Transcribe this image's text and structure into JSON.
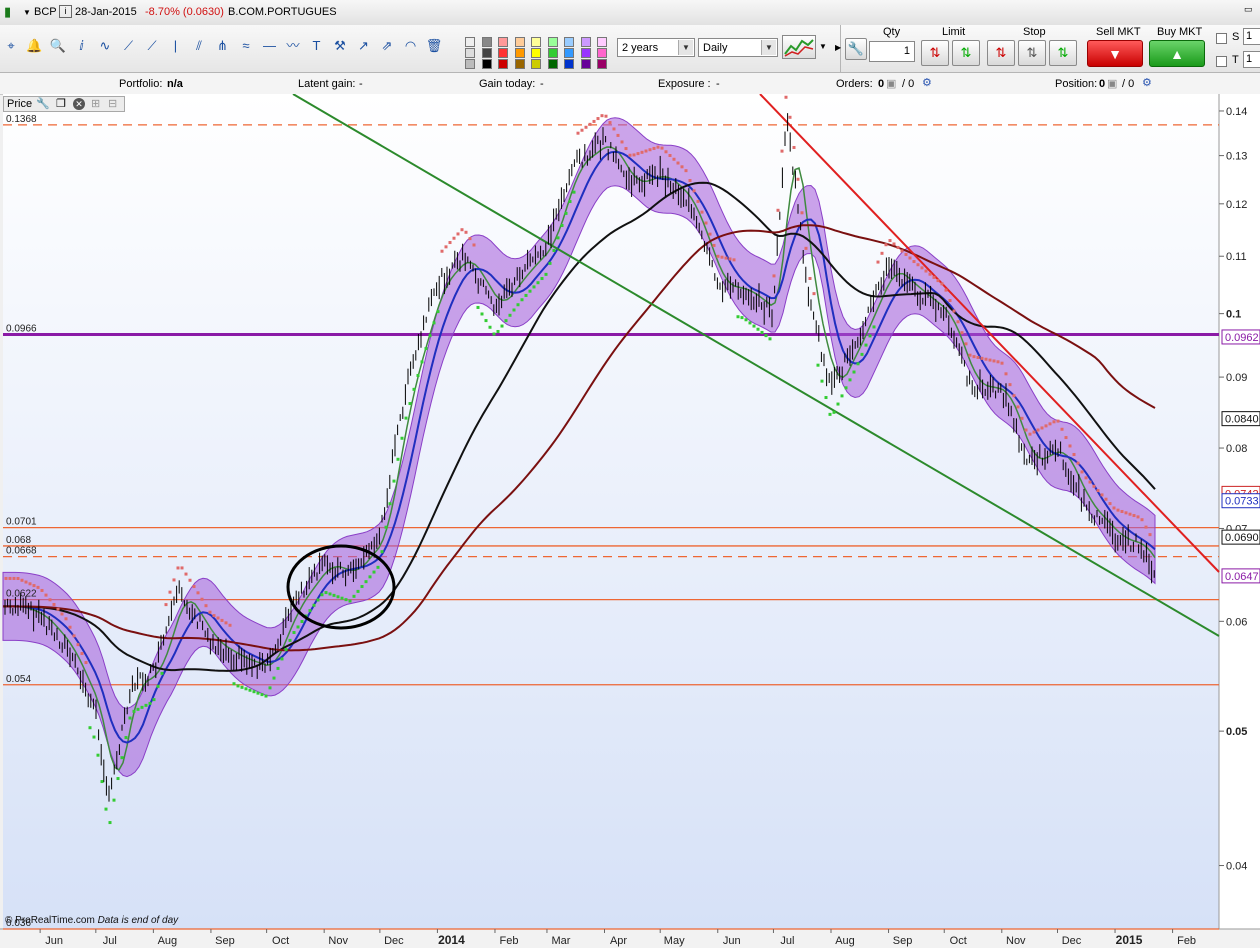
{
  "header": {
    "symbol": "BCP",
    "date": "28-Jan-2015",
    "change": "-8.70% (0.0630)",
    "name": "B.COM.PORTUGUES",
    "info_icon": "info-icon"
  },
  "toolbar": {
    "period": "2 years",
    "interval": "Daily",
    "icons": [
      "crosshair-icon",
      "alert-bell-icon",
      "zoom-icon",
      "fibonacci-icon",
      "indicator-icon",
      "line-tool-icon",
      "ray-tool-icon",
      "vertical-line-icon",
      "parallel-channel-icon",
      "pitchfork-icon",
      "regression-icon",
      "horizontal-line-icon",
      "trend-icon",
      "text-icon",
      "tools-icon",
      "arrow-icon",
      "arrow-pair-icon",
      "arc-icon",
      "trash-icon"
    ],
    "swatches": [
      "#eeeeee",
      "#dddddd",
      "#bbbbbb",
      "#888888",
      "#444444",
      "#000000",
      "#ff9999",
      "#ff3333",
      "#cc0000",
      "#ffcc99",
      "#ff9900",
      "#996600",
      "#ffff99",
      "#ffff00",
      "#cccc00",
      "#99ff99",
      "#33cc33",
      "#006600",
      "#99ccff",
      "#3399ff",
      "#0033cc",
      "#cc99ff",
      "#9933ff",
      "#660099",
      "#ffccff",
      "#ff66cc",
      "#990066"
    ]
  },
  "order": {
    "qty_label": "Qty",
    "qty_value": "1",
    "limit_label": "Limit",
    "stop_label": "Stop",
    "sell_label": "Sell MKT",
    "buy_label": "Buy MKT",
    "s_label": "S",
    "t_label": "T",
    "s_value": "1",
    "t_value": "1"
  },
  "info": {
    "portfolio_label": "Portfolio:",
    "portfolio_value": "n/a",
    "latent_label": "Latent gain:",
    "latent_value": "-",
    "gain_today_label": "Gain today:",
    "gain_today_value": "-",
    "exposure_label": "Exposure :",
    "exposure_value": "-",
    "orders_label": "Orders:",
    "orders_value": "0",
    "orders_value2": "/ 0",
    "position_label": "Position:",
    "position_value": "0",
    "position_value2": "/ 0"
  },
  "price_panel": {
    "label": "Price"
  },
  "footer": {
    "copyright": "© ProRealTime.com",
    "note": "Data is end of day"
  },
  "colors": {
    "band_fill": "#a259d9",
    "ma_blue": "#1f2fbf",
    "ma_black": "#111111",
    "ma_maroon": "#7a1010",
    "ma_green": "#3f8a3f",
    "trend_green": "#2c8a2c",
    "trend_red": "#e02020",
    "support_orange": "#ee6633",
    "resistance_purple": "#8a1aa6",
    "sar_green": "#33cc33",
    "sar_red": "#e06a6a"
  },
  "chart_data": {
    "type": "candlestick",
    "scale": "log",
    "ylim": [
      0.036,
      0.144
    ],
    "y_ticks": [
      0.04,
      0.05,
      0.06,
      0.07,
      0.08,
      0.09,
      0.1,
      0.11,
      0.12,
      0.13,
      0.14
    ],
    "y_tick_labels": [
      "0.04",
      "0.05",
      "0.06",
      "0.07",
      "0.08",
      "0.09",
      "0.1",
      "0.11",
      "0.12",
      "0.13",
      "0.14"
    ],
    "y_major_ticks": [
      "0.05",
      "0.1"
    ],
    "x_labels": [
      "Jun",
      "Jul",
      "Aug",
      "Sep",
      "Oct",
      "Nov",
      "Dec",
      "2014",
      "Feb",
      "Mar",
      "Apr",
      "May",
      "Jun",
      "Jul",
      "Aug",
      "Sep",
      "Oct",
      "Nov",
      "Dec",
      "2015",
      "Feb"
    ],
    "x_major_labels": [
      "2014",
      "2015"
    ],
    "horizontal_lines": [
      {
        "label": "0.1368",
        "value": 0.1368,
        "style": "dashed",
        "color": "orange"
      },
      {
        "label": "0.0966",
        "value": 0.0966,
        "style": "solid-thick",
        "color": "purple"
      },
      {
        "label": "0.0701",
        "value": 0.0701,
        "style": "solid",
        "color": "orange"
      },
      {
        "label": "0.068",
        "value": 0.068,
        "style": "solid",
        "color": "orange"
      },
      {
        "label": "0.0668",
        "value": 0.0668,
        "style": "dashed",
        "color": "orange"
      },
      {
        "label": "0.0622",
        "value": 0.0622,
        "style": "solid",
        "color": "orange"
      },
      {
        "label": "0.054",
        "value": 0.054,
        "style": "solid",
        "color": "orange"
      },
      {
        "label": "0.036",
        "value": 0.036,
        "style": "solid",
        "color": "orange"
      }
    ],
    "right_labels": [
      {
        "text": "0.0962",
        "value": 0.0962,
        "color": "#8a1aa6"
      },
      {
        "text": "0.0840",
        "value": 0.084,
        "color": "#111111"
      },
      {
        "text": "0.0742",
        "value": 0.0742,
        "color": "#cc2222"
      },
      {
        "text": "0.0733",
        "value": 0.0733,
        "color": "#1f2fbf"
      },
      {
        "text": "0.0690",
        "value": 0.069,
        "color": "#111111"
      },
      {
        "text": "0.0647",
        "value": 0.0647,
        "color": "#8a1aa6"
      }
    ],
    "close_series": [
      {
        "x": "2013-05-20",
        "close": 0.0615
      },
      {
        "x": "2013-06-01",
        "close": 0.0605
      },
      {
        "x": "2013-06-15",
        "close": 0.0575
      },
      {
        "x": "2013-07-01",
        "close": 0.0515
      },
      {
        "x": "2013-07-08",
        "close": 0.0445
      },
      {
        "x": "2013-07-20",
        "close": 0.054
      },
      {
        "x": "2013-08-01",
        "close": 0.055
      },
      {
        "x": "2013-08-15",
        "close": 0.063
      },
      {
        "x": "2013-09-01",
        "close": 0.058
      },
      {
        "x": "2013-09-15",
        "close": 0.0565
      },
      {
        "x": "2013-10-01",
        "close": 0.0555
      },
      {
        "x": "2013-10-15",
        "close": 0.0615
      },
      {
        "x": "2013-11-01",
        "close": 0.066
      },
      {
        "x": "2013-11-15",
        "close": 0.065
      },
      {
        "x": "2013-12-01",
        "close": 0.069
      },
      {
        "x": "2013-12-15",
        "close": 0.088
      },
      {
        "x": "2014-01-01",
        "close": 0.105
      },
      {
        "x": "2014-01-15",
        "close": 0.11
      },
      {
        "x": "2014-02-01",
        "close": 0.101
      },
      {
        "x": "2014-02-15",
        "close": 0.107
      },
      {
        "x": "2014-03-01",
        "close": 0.112
      },
      {
        "x": "2014-03-15",
        "close": 0.128
      },
      {
        "x": "2014-04-01",
        "close": 0.133
      },
      {
        "x": "2014-04-15",
        "close": 0.124
      },
      {
        "x": "2014-05-01",
        "close": 0.126
      },
      {
        "x": "2014-05-15",
        "close": 0.121
      },
      {
        "x": "2014-06-01",
        "close": 0.105
      },
      {
        "x": "2014-06-15",
        "close": 0.104
      },
      {
        "x": "2014-07-01",
        "close": 0.1
      },
      {
        "x": "2014-07-08",
        "close": 0.138
      },
      {
        "x": "2014-07-20",
        "close": 0.102
      },
      {
        "x": "2014-08-01",
        "close": 0.088
      },
      {
        "x": "2014-08-15",
        "close": 0.096
      },
      {
        "x": "2014-09-01",
        "close": 0.108
      },
      {
        "x": "2014-09-15",
        "close": 0.104
      },
      {
        "x": "2014-10-01",
        "close": 0.1
      },
      {
        "x": "2014-10-15",
        "close": 0.089
      },
      {
        "x": "2014-11-01",
        "close": 0.088
      },
      {
        "x": "2014-11-15",
        "close": 0.078
      },
      {
        "x": "2014-12-01",
        "close": 0.08
      },
      {
        "x": "2014-12-15",
        "close": 0.073
      },
      {
        "x": "2015-01-01",
        "close": 0.069
      },
      {
        "x": "2015-01-15",
        "close": 0.068
      },
      {
        "x": "2015-01-28",
        "close": 0.063
      }
    ]
  }
}
